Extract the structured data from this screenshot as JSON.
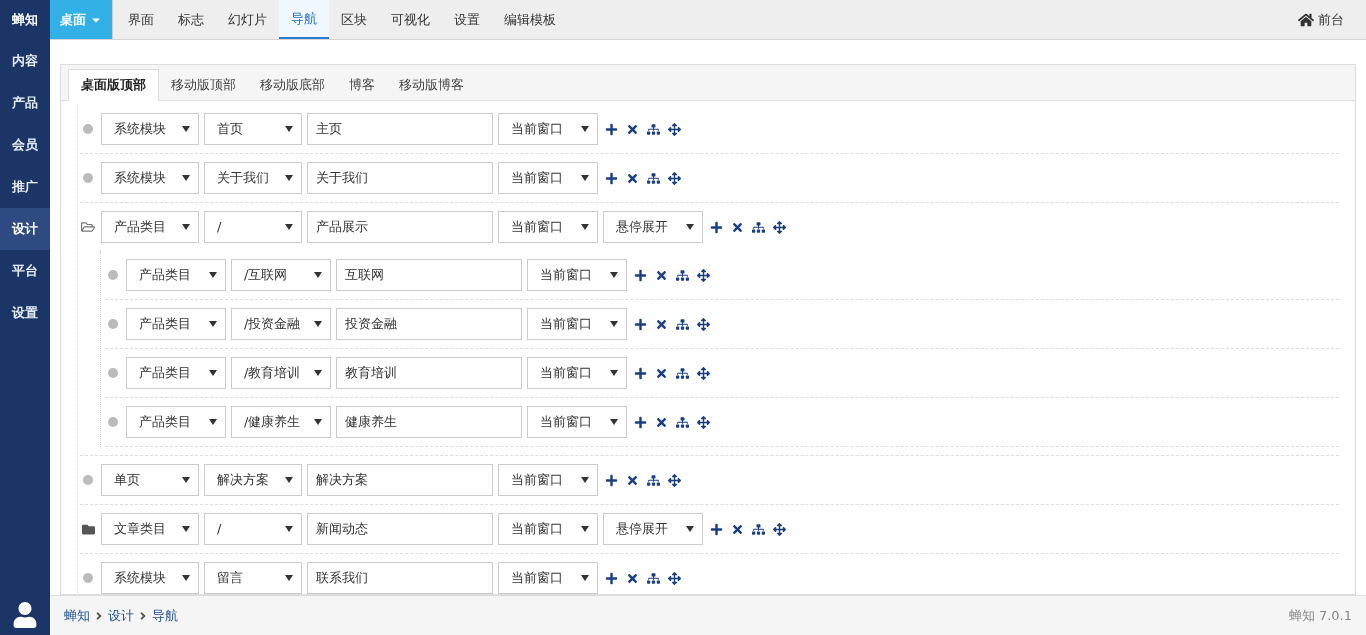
{
  "sidebar": {
    "brand": "蝉知",
    "items": [
      {
        "label": "内容",
        "selected": false
      },
      {
        "label": "产品",
        "selected": false
      },
      {
        "label": "会员",
        "selected": false
      },
      {
        "label": "推广",
        "selected": false
      },
      {
        "label": "设计",
        "selected": true
      },
      {
        "label": "平台",
        "selected": false
      },
      {
        "label": "设置",
        "selected": false
      }
    ]
  },
  "topbar": {
    "menu_button": "桌面",
    "tabs": [
      {
        "label": "界面",
        "selected": false
      },
      {
        "label": "标志",
        "selected": false
      },
      {
        "label": "幻灯片",
        "selected": false
      },
      {
        "label": "导航",
        "selected": true
      },
      {
        "label": "区块",
        "selected": false
      },
      {
        "label": "可视化",
        "selected": false
      },
      {
        "label": "设置",
        "selected": false
      },
      {
        "label": "编辑模板",
        "selected": false
      }
    ],
    "frontend_link": "前台"
  },
  "panel_tabs": [
    {
      "label": "桌面版顶部",
      "selected": true
    },
    {
      "label": "移动版顶部",
      "selected": false
    },
    {
      "label": "移动版底部",
      "selected": false
    },
    {
      "label": "博客",
      "selected": false
    },
    {
      "label": "移动版博客",
      "selected": false
    }
  ],
  "nav_items": [
    {
      "kind": "leaf",
      "type": "系统模块",
      "target": "首页",
      "name": "主页",
      "window": "当前窗口"
    },
    {
      "kind": "leaf",
      "type": "系统模块",
      "target": "关于我们",
      "name": "关于我们",
      "window": "当前窗口"
    },
    {
      "kind": "folder",
      "expanded": true,
      "type": "产品类目",
      "target": "/",
      "name": "产品展示",
      "window": "当前窗口",
      "hover": "悬停展开",
      "children": [
        {
          "kind": "leaf",
          "type": "产品类目",
          "target": "/互联网",
          "name": "互联网",
          "window": "当前窗口"
        },
        {
          "kind": "leaf",
          "type": "产品类目",
          "target": "/投资金融",
          "name": "投资金融",
          "window": "当前窗口"
        },
        {
          "kind": "leaf",
          "type": "产品类目",
          "target": "/教育培训",
          "name": "教育培训",
          "window": "当前窗口"
        },
        {
          "kind": "leaf",
          "type": "产品类目",
          "target": "/健康养生",
          "name": "健康养生",
          "window": "当前窗口"
        }
      ]
    },
    {
      "kind": "leaf",
      "type": "单页",
      "target": "解决方案",
      "name": "解决方案",
      "window": "当前窗口"
    },
    {
      "kind": "folder",
      "expanded": false,
      "type": "文章类目",
      "target": "/",
      "name": "新闻动态",
      "window": "当前窗口",
      "hover": "悬停展开"
    },
    {
      "kind": "leaf",
      "type": "系统模块",
      "target": "留言",
      "name": "联系我们",
      "window": "当前窗口"
    }
  ],
  "footer": {
    "breadcrumb": [
      "蝉知",
      "设计",
      "导航"
    ],
    "version": "蝉知 7.0.1"
  }
}
